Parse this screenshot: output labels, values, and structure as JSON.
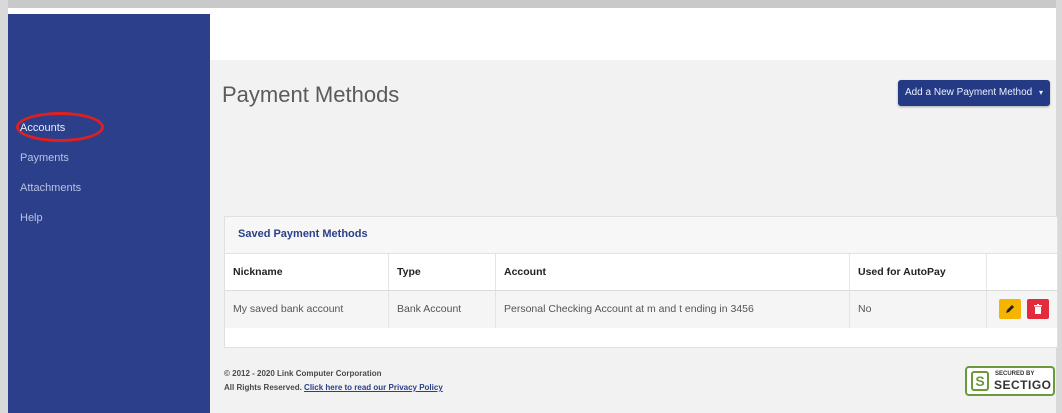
{
  "sidebar": {
    "items": [
      {
        "label": "Accounts"
      },
      {
        "label": "Payments"
      },
      {
        "label": "Attachments"
      },
      {
        "label": "Help"
      }
    ]
  },
  "header": {
    "title": "Payment Methods",
    "add_button_label": "Add a New Payment Method"
  },
  "panel": {
    "title": "Saved Payment Methods",
    "columns": [
      "Nickname",
      "Type",
      "Account",
      "Used for AutoPay",
      ""
    ],
    "rows": [
      {
        "nickname": "My saved bank account",
        "type": "Bank Account",
        "account": "Personal Checking Account at m and t ending in 3456",
        "autopay": "No"
      }
    ]
  },
  "footer": {
    "copyright": "© 2012 - 2020 Link Computer Corporation",
    "rights": "All Rights Reserved.",
    "privacy_link": "Click here to read our Privacy Policy"
  },
  "badge": {
    "top_text": "SECURED BY",
    "bottom_text": "SECTIGO",
    "logo_letter": "S"
  },
  "icons": {
    "edit": "pencil-icon",
    "delete": "trash-icon",
    "dropdown": "caret-down-icon"
  },
  "colors": {
    "sidebar": "#2b3f8a",
    "primary_button": "#243a84",
    "edit_button": "#f4b400",
    "delete_button": "#e32b3b",
    "highlight": "#e0201f"
  }
}
